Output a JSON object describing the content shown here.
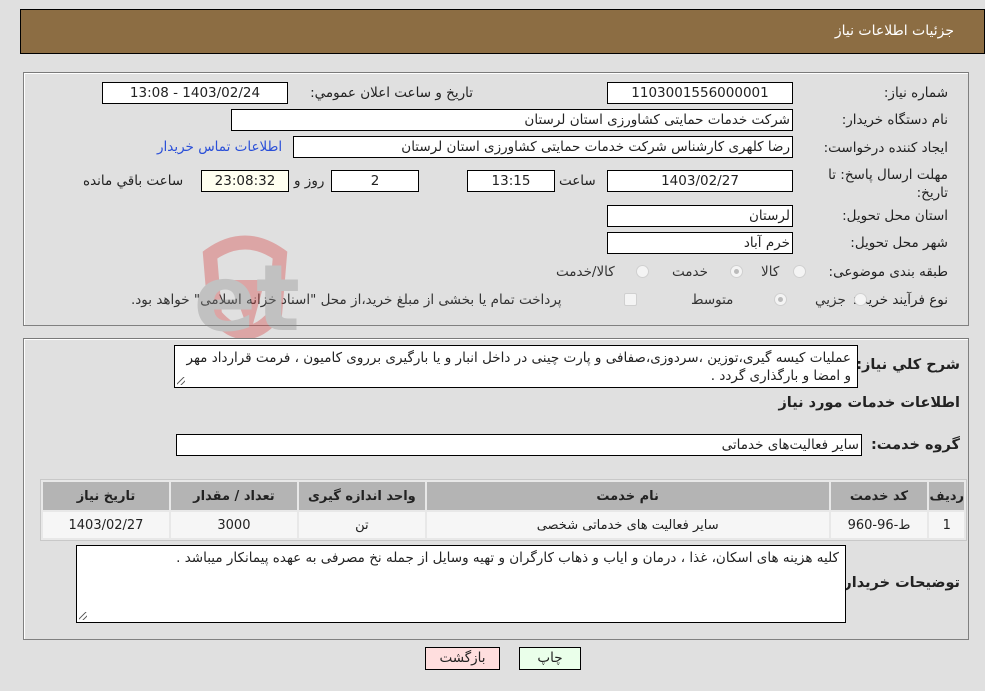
{
  "header": {
    "title": "جزئیات اطلاعات نیاز"
  },
  "details": {
    "need_number": {
      "label": "شماره نیاز:",
      "value": "1103001556000001"
    },
    "announce_datetime": {
      "label": "تاریخ و ساعت اعلان عمومي:",
      "value": "1403/02/24 - 13:08"
    },
    "buyer_org": {
      "label": "نام دستگاه خریدار:",
      "value": "شرکت خدمات حمایتی کشاورزی استان لرستان"
    },
    "requester": {
      "label": "ایجاد کننده درخواست:",
      "value": "رضا کلهری کارشناس شرکت خدمات حمایتی کشاورزی استان لرستان"
    },
    "buyer_contact_link": "اطلاعات تماس خریدار",
    "deadline": {
      "label": "مهلت ارسال پاسخ: تا تاریخ:",
      "date": "1403/02/27",
      "time_label": "ساعت",
      "time": "13:15",
      "days": "2",
      "days_label": "روز و",
      "remaining": "23:08:32",
      "remaining_label": "ساعت باقي مانده"
    },
    "delivery_province": {
      "label": "استان محل تحویل:",
      "value": "لرستان"
    },
    "delivery_city": {
      "label": "شهر محل تحویل:",
      "value": "خرم آباد"
    },
    "category": {
      "label": "طبقه بندی موضوعی:",
      "options": [
        "کالا",
        "خدمت",
        "کالا/خدمت"
      ],
      "selected": "خدمت"
    },
    "purchase_type": {
      "label": "نوع فرآیند خرید :",
      "options": [
        "جزيي",
        "متوسط"
      ],
      "selected": "متوسط",
      "treasury_note": "پرداخت تمام یا بخشی از مبلغ خرید،از محل \"اسناد خزانه اسلامی\" خواهد بود."
    }
  },
  "description": {
    "label": "شرح کلي نیاز:",
    "value": "عملیات کیسه گیری،توزین ،سردوزی،صفافی و پارت چینی در داخل انبار و یا بارگیری برروی کامیون  ، فرمت قرارداد مهر و امضا و بارگذاری گردد ."
  },
  "services": {
    "section_title": "اطلاعات خدمات مورد نیاز",
    "group_label": "گروه خدمت:",
    "group_value": "سایر فعالیت‌های خدماتی",
    "table": {
      "headers": [
        "ردیف",
        "کد خدمت",
        "نام خدمت",
        "واحد اندازه گیری",
        "تعداد / مقدار",
        "تاریخ نیاز"
      ],
      "rows": [
        [
          "1",
          "ط-96-960",
          "سایر فعالیت های خدماتی شخصی",
          "تن",
          "3000",
          "1403/02/27"
        ]
      ]
    }
  },
  "buyer_notes": {
    "label": "توضیحات خریدار:",
    "value": "کلیه هزینه های اسکان، غذا ، درمان و ایاب و ذهاب کارگران و تهیه وسایل از جمله نخ مصرفی  به عهده پیمانکار میباشد ."
  },
  "buttons": {
    "print": "چاپ",
    "back": "بازگشت"
  },
  "colors": {
    "header_bg": "#8c6d43",
    "print_bg": "#eaffea",
    "back_bg": "#ffdede",
    "remaining_bg": "#fffff0",
    "link": "#2a4fd8"
  },
  "watermark": "AriaTender.net"
}
